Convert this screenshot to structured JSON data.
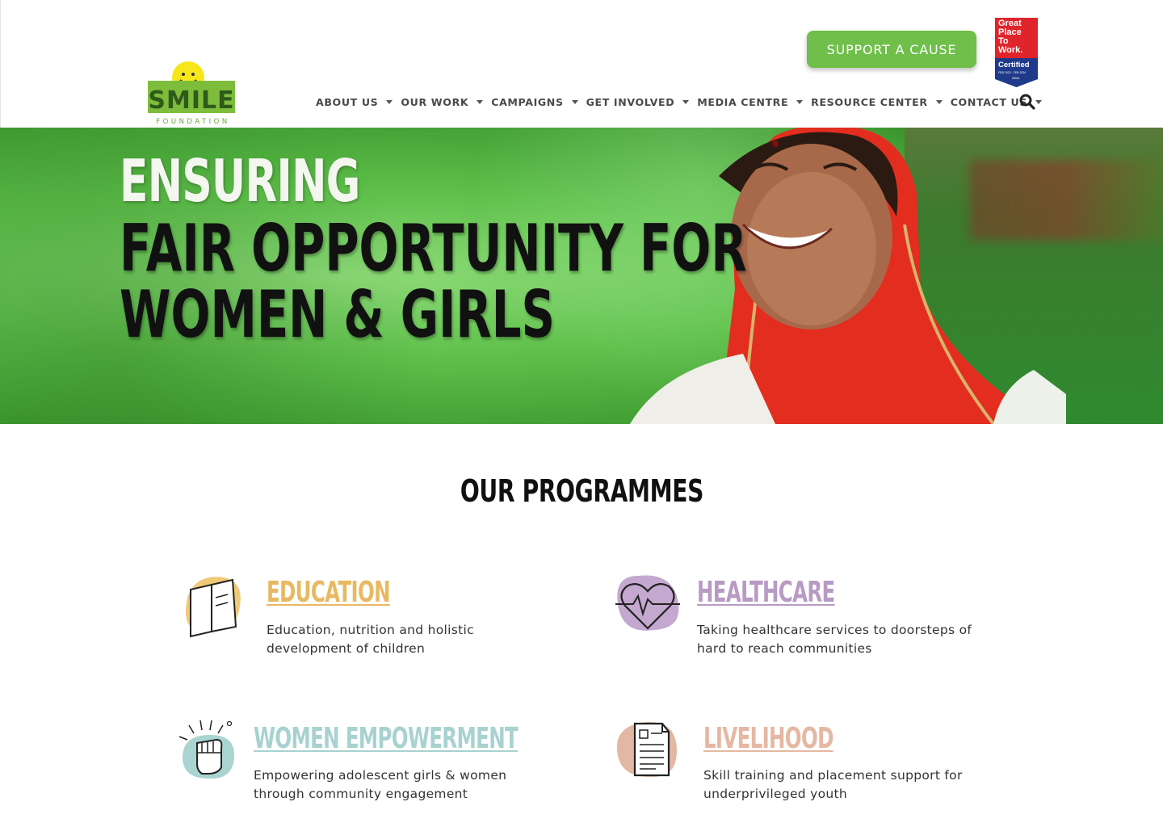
{
  "header": {
    "logo_text": "SMILE",
    "logo_subtext": "FOUNDATION",
    "support_label": "SUPPORT A CAUSE",
    "badge_lines": [
      "Great",
      "Place",
      "To",
      "Work.",
      "Certified",
      "FEB 2023 - FEB 2024",
      "INDIA"
    ],
    "nav": [
      {
        "label": "ABOUT US",
        "has_caret": true
      },
      {
        "label": "OUR WORK",
        "has_caret": true
      },
      {
        "label": "CAMPAIGNS",
        "has_caret": true
      },
      {
        "label": "GET INVOLVED",
        "has_caret": true
      },
      {
        "label": "MEDIA CENTRE",
        "has_caret": true
      },
      {
        "label": "RESOURCE CENTER",
        "has_caret": true
      },
      {
        "label": "CONTACT US",
        "has_caret": true
      }
    ],
    "search_icon": "search-icon"
  },
  "hero": {
    "line1": "ENSURING",
    "line2": "FAIR OPPORTUNITY FOR",
    "line3": "WOMEN & GIRLS"
  },
  "programmes": {
    "title": "OUR PROGRAMMES",
    "items": [
      {
        "title": "EDUCATION",
        "desc": "Education, nutrition and holistic development of children",
        "color": "#e8b962",
        "blob": "#f0c979",
        "icon": "book-icon"
      },
      {
        "title": "HEALTHCARE",
        "desc": "Taking healthcare services to doorsteps of hard to reach communities",
        "color": "#b79bc4",
        "blob": "#c4a8d0",
        "icon": "heart-pulse-icon"
      },
      {
        "title": "WOMEN EMPOWERMENT",
        "desc": "Empowering adolescent girls & women through community engagement",
        "color": "#a7d2cf",
        "blob": "#a9d4d1",
        "icon": "raised-fist-icon"
      },
      {
        "title": "LIVELIHOOD",
        "desc": "Skill training and placement support for underprivileged youth",
        "color": "#e6b7a2",
        "blob": "#e2b8a4",
        "icon": "document-icon"
      }
    ]
  },
  "colors": {
    "brand_green": "#6fbf4a",
    "gptw_red": "#e0242b",
    "gptw_blue": "#1f3a8a"
  }
}
